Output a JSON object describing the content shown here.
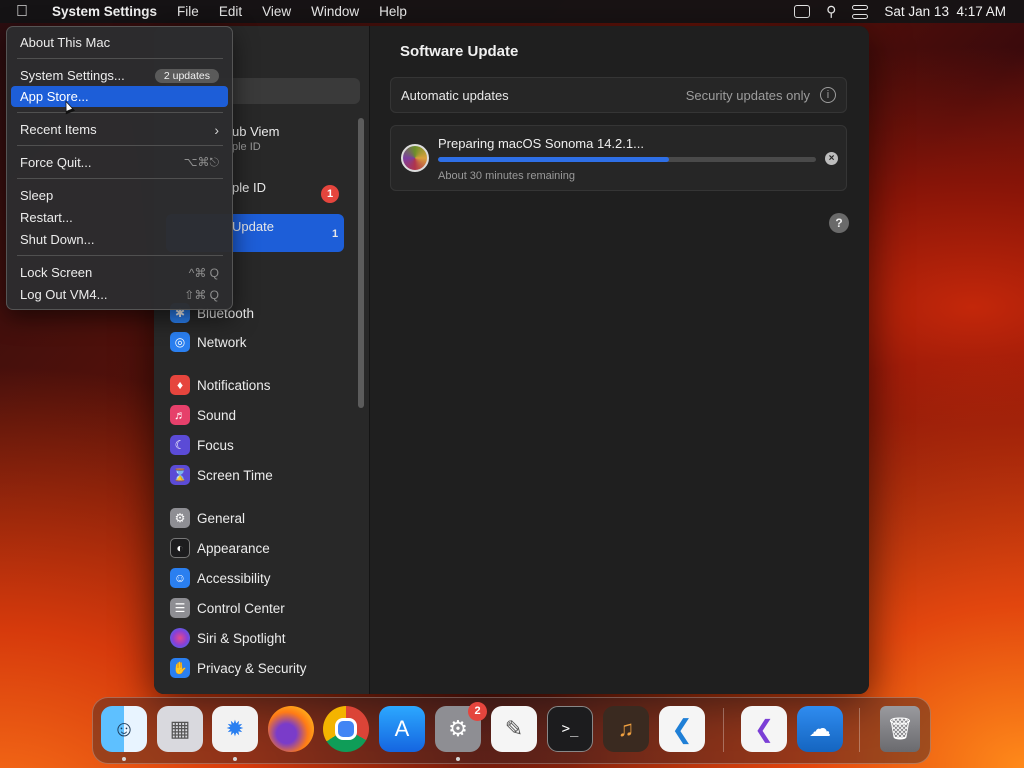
{
  "menubar": {
    "app_name": "System Settings",
    "items": [
      "File",
      "Edit",
      "View",
      "Window",
      "Help"
    ],
    "clock": "Sat Jan 13  4:17 AM"
  },
  "apple_menu": {
    "about": "About This Mac",
    "system_settings": "System Settings...",
    "updates_pill": "2 updates",
    "app_store": "App Store...",
    "recent_items": "Recent Items",
    "force_quit": "Force Quit...",
    "force_quit_shortcut": "⌥⌘⎋",
    "sleep": "Sleep",
    "restart": "Restart...",
    "shut_down": "Shut Down...",
    "lock_screen": "Lock Screen",
    "lock_shortcut": "^⌘ Q",
    "log_out": "Log Out VM4...",
    "log_out_shortcut": "⇧⌘ Q"
  },
  "sidebar": {
    "account_name": "ub Viem",
    "account_sub": "ple ID",
    "apple_id_label": "ple ID",
    "apple_id_badge": "1",
    "software_update_label": "Update",
    "software_update_badge": "1",
    "items": [
      {
        "label": "Bluetooth",
        "icon": "bluetooth-icon",
        "color": "#2a7ff0"
      },
      {
        "label": "Network",
        "icon": "globe-icon",
        "color": "#2a7ff0"
      },
      {
        "label": "Notifications",
        "icon": "bell-icon",
        "color": "#e6453d"
      },
      {
        "label": "Sound",
        "icon": "speaker-icon",
        "color": "#e6406a"
      },
      {
        "label": "Focus",
        "icon": "moon-icon",
        "color": "#5b4bd6"
      },
      {
        "label": "Screen Time",
        "icon": "hourglass-icon",
        "color": "#5b4bd6"
      },
      {
        "label": "General",
        "icon": "gear-icon",
        "color": "#8e8e93"
      },
      {
        "label": "Appearance",
        "icon": "appearance-icon",
        "color": "#1c1c1e"
      },
      {
        "label": "Accessibility",
        "icon": "accessibility-icon",
        "color": "#2a7ff0"
      },
      {
        "label": "Control Center",
        "icon": "control-center-icon",
        "color": "#8e8e93"
      },
      {
        "label": "Siri & Spotlight",
        "icon": "siri-icon",
        "color": "#8a3fd6"
      },
      {
        "label": "Privacy & Security",
        "icon": "hand-icon",
        "color": "#2a7ff0"
      }
    ]
  },
  "main": {
    "title": "Software Update",
    "auto_updates_label": "Automatic updates",
    "auto_updates_value": "Security updates only",
    "update_title": "Preparing macOS Sonoma 14.2.1...",
    "update_progress": 0.61,
    "update_remaining": "About 30 minutes remaining"
  },
  "dock": {
    "system_settings_badge": "2"
  }
}
